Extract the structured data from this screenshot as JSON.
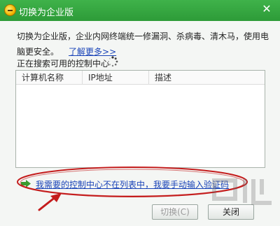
{
  "window": {
    "title": "切换为企业版",
    "close_glyph": "✕"
  },
  "description": {
    "text": "切换为企业版，企业内网终端统一修漏洞、杀病毒、清木马，使用电脑更安全。",
    "more_link": "了解更多>>"
  },
  "search_status": "正在搜索可用的控制中心",
  "list": {
    "columns": [
      "计算机名称",
      "IP地址",
      "描述"
    ]
  },
  "manual_link": "我需要的控制中心不在列表中，我要手动输入验证码",
  "buttons": {
    "switch": "切换(C)",
    "close": "关闭"
  },
  "colors": {
    "titlebar": "#35a840",
    "link": "#1a44b8",
    "annotation": "#c41c1c"
  },
  "icons": {
    "app": "qq-manager-icon",
    "spinner": "loading-spinner-icon",
    "manual": "green-arrow-icon"
  }
}
